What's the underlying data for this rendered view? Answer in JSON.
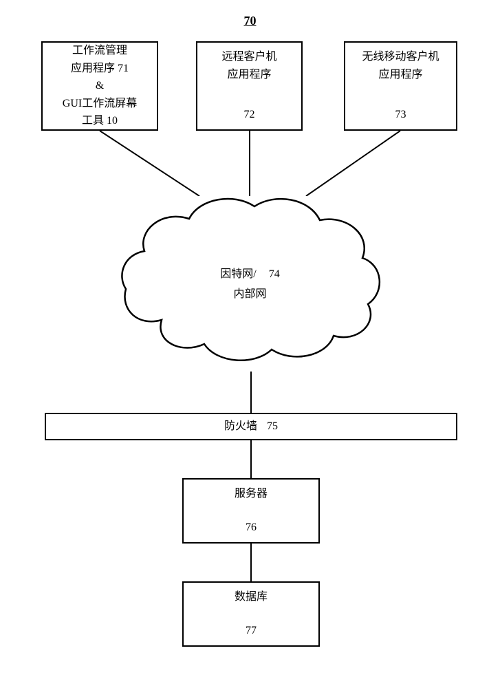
{
  "figure_number": "70",
  "box1": {
    "line1": "工作流管理",
    "line2": "应用程序 71",
    "amp": "&",
    "line3": "GUI工作流屏幕",
    "line4": "工具 10"
  },
  "box2": {
    "line1": "远程客户机",
    "line2": "应用程序",
    "number": "72"
  },
  "box3": {
    "line1": "无线移动客户机",
    "line2": "应用程序",
    "number": "73"
  },
  "cloud": {
    "line1": "因特网/",
    "line2": "内部网",
    "number": "74"
  },
  "firewall": {
    "label": "防火墙",
    "number": "75"
  },
  "server": {
    "label": "服务器",
    "number": "76"
  },
  "database": {
    "label": "数据库",
    "number": "77"
  }
}
